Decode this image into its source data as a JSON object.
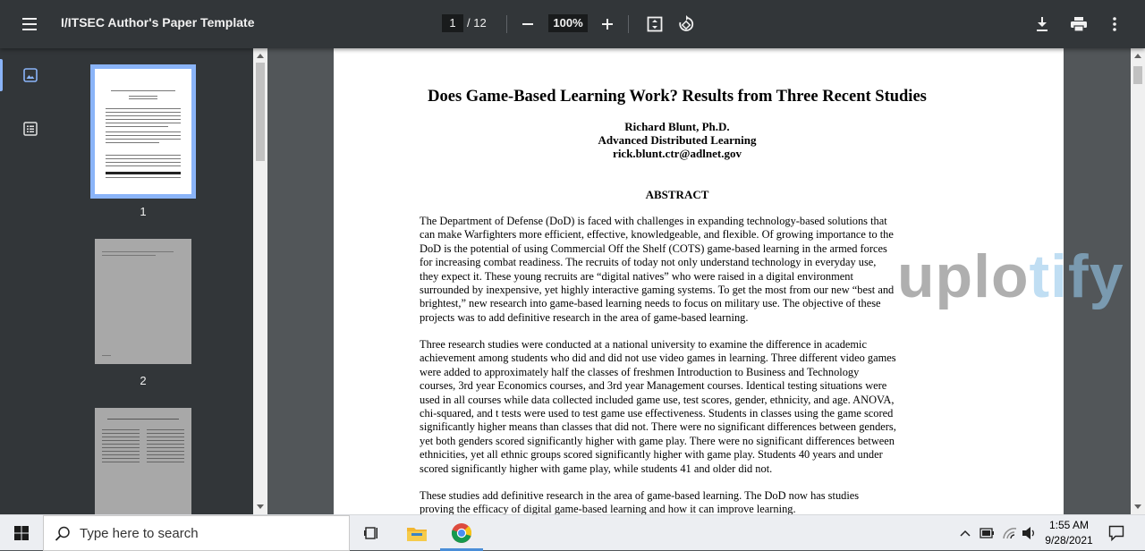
{
  "toolbar": {
    "title": "I/ITSEC Author's Paper Template",
    "current_page": "1",
    "total_pages": "/ 12",
    "zoom": "100%",
    "icons": [
      "menu-icon",
      "zoom-out-icon",
      "zoom-in-icon",
      "fit-page-icon",
      "rotate-icon",
      "download-icon",
      "print-icon",
      "more-vert-icon"
    ]
  },
  "sidebar": {
    "icons": [
      "thumbnails-icon",
      "outline-icon"
    ],
    "thumbnails": [
      {
        "label": "1"
      },
      {
        "label": "2"
      },
      {
        "label": ""
      }
    ]
  },
  "document": {
    "title": "Does Game-Based Learning Work? Results from Three Recent Studies",
    "author_name": "Richard Blunt, Ph.D.",
    "author_org": "Advanced Distributed Learning",
    "author_email": "rick.blunt.ctr@adlnet.gov",
    "abstract_heading": "ABSTRACT",
    "para1_lines": [
      "The Department of Defense (DoD) is faced with challenges in expanding technology-based solutions that",
      "can make Warfighters more efficient, effective, knowledgeable, and flexible.  Of growing importance to the",
      "DoD is the potential of using Commercial Off the Shelf (COTS) game-based learning in the armed forces",
      "for increasing combat readiness.  The recruits of today not only understand technology in everyday use,",
      "they expect it.  These young recruits are “digital natives” who were raised in a digital environment",
      "surrounded by inexpensive, yet highly interactive gaming systems.  To get the most from our new “best and",
      "brightest,” new research into game-based learning needs to focus on military use.  The objective of these",
      "projects was to add definitive research in the area of game-based learning."
    ],
    "para2_lines": [
      "Three research studies were conducted at a national university to examine the difference in academic",
      "achievement among students who did and did not use video games in learning. Three different video games",
      "were added to approximately half the classes of freshmen Introduction to Business and Technology",
      "courses, 3rd year Economics courses, and 3rd year Management courses. Identical testing situations were",
      "used in all courses while data collected included game use, test scores, gender, ethnicity, and age. ANOVA,",
      "chi-squared, and t tests were used to test game use effectiveness.  Students in classes using the game scored",
      "significantly higher means than classes that did not. There were no significant differences between genders,",
      "yet both genders scored significantly higher with game play. There were no significant differences between",
      "ethnicities, yet all ethnic groups scored significantly higher with game play. Students 40 years and under",
      "scored significantly higher with game play, while students 41 and older did not."
    ],
    "para3_lines": [
      "These studies add definitive research in the area of game-based learning.  The DoD now has studies",
      "proving the efficacy of digital game-based learning and how it can improve learning."
    ]
  },
  "watermark": {
    "text_main": "uplo",
    "text_accent": "tify",
    "color_main": "#6e6e6e",
    "color_accent": "#96c8eb"
  },
  "taskbar": {
    "search_placeholder": "Type here to search",
    "time": "1:55 AM",
    "date": "9/28/2021",
    "icons": [
      "windows-start-icon",
      "search-icon",
      "task-view-icon",
      "file-explorer-icon",
      "chrome-icon",
      "tray-chevron-icon",
      "battery-icon",
      "wifi-icon",
      "volume-icon",
      "notification-icon"
    ]
  },
  "colors": {
    "toolbar_bg": "#323639",
    "doc_bg": "#525659",
    "accent": "#8ab4f8"
  }
}
